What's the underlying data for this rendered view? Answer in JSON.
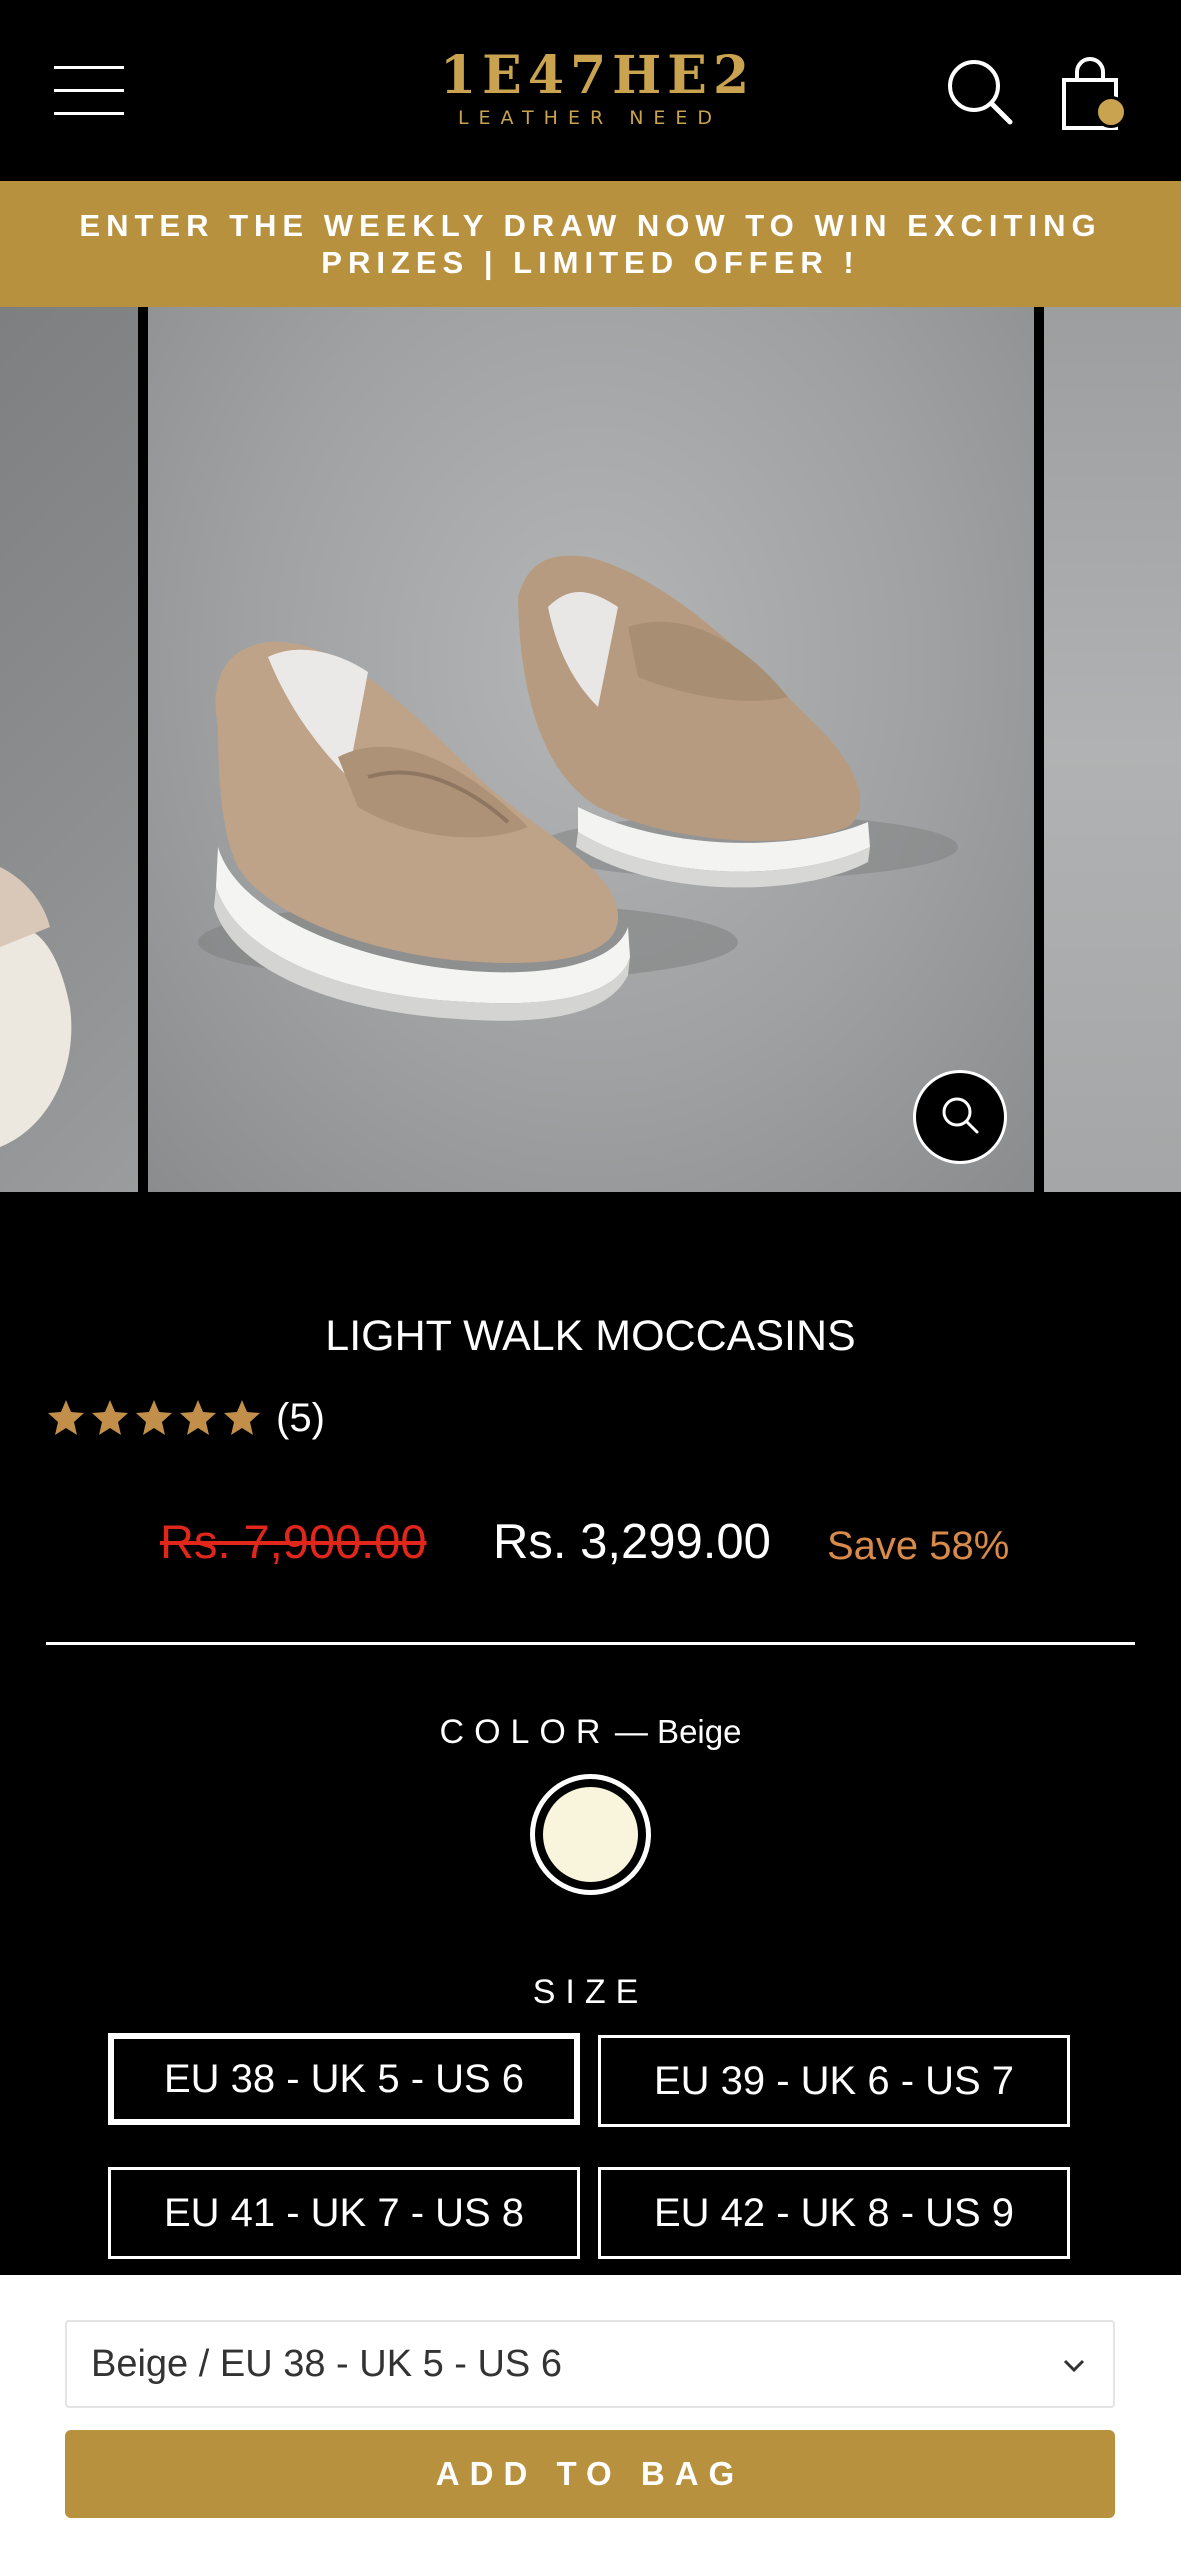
{
  "header": {
    "logo_main": "1E47HE2",
    "logo_sub": "LEATHER NEED",
    "icons": [
      "menu-icon",
      "search-icon",
      "bag-icon"
    ],
    "accent_color": "#c9a34f"
  },
  "announcement": {
    "text": "ENTER THE WEEKLY DRAW NOW TO WIN EXCITING PRIZES | LIMITED OFFER !",
    "background": "#b8913f"
  },
  "product": {
    "title": "LIGHT WALK MOCCASINS",
    "rating_stars": 5,
    "review_count": "(5)",
    "compare_price": "Rs. 7,900.00",
    "price": "Rs. 3,299.00",
    "save": "Save 58%"
  },
  "color": {
    "label": "COLOR",
    "value": "— Beige",
    "swatches": [
      {
        "name": "Beige",
        "hex": "#f8f5dc",
        "selected": true
      }
    ]
  },
  "size": {
    "label": "SIZE",
    "options": [
      {
        "label": "EU 38 - UK 5 - US 6",
        "selected": true
      },
      {
        "label": "EU 39 - UK 6 - US 7",
        "selected": false
      },
      {
        "label": "EU 41 - UK 7 - US 8",
        "selected": false
      },
      {
        "label": "EU 42 - UK 8 - US 9",
        "selected": false
      }
    ]
  },
  "sticky": {
    "variant_value": "Beige / EU 38 - UK 5 - US 6",
    "add_to_bag": "ADD TO BAG"
  }
}
